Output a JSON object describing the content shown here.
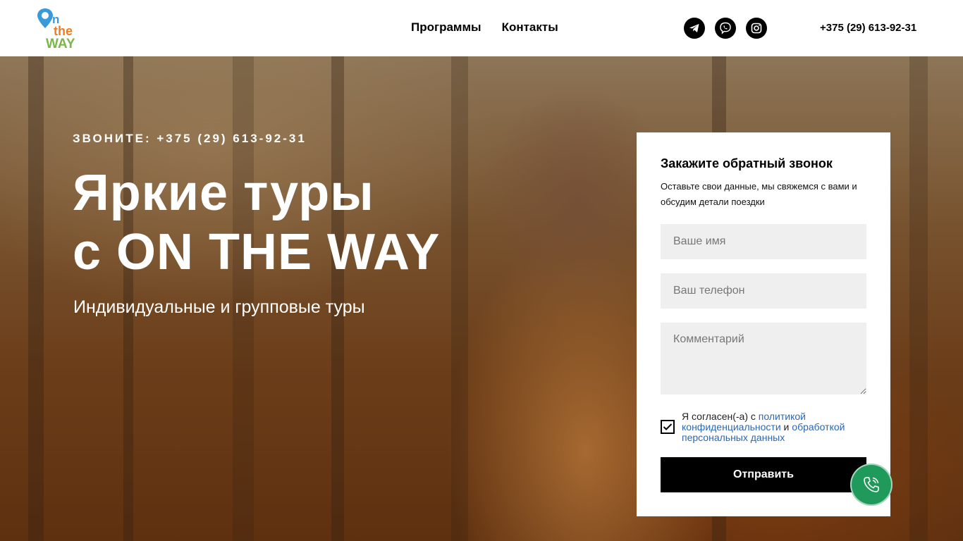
{
  "header": {
    "logo_text": [
      "On",
      "the",
      "WAY"
    ],
    "nav": [
      {
        "label": "Программы"
      },
      {
        "label": "Контакты"
      }
    ],
    "socials": [
      {
        "icon": "telegram-icon"
      },
      {
        "icon": "viber-icon"
      },
      {
        "icon": "instagram-icon"
      }
    ],
    "phone": "+375 (29) 613-92-31"
  },
  "hero": {
    "eyebrow": "ЗВОНИТЕ: +375 (29) 613-92-31",
    "title_line1": "Яркие туры",
    "title_line2": "с ON THE WAY",
    "subtitle": "Индивидуальные и групповые туры"
  },
  "form": {
    "title": "Закажите обратный звонок",
    "description": "Оставьте свои данные, мы свяжемся с вами и обсудим детали поездки",
    "name_placeholder": "Ваше имя",
    "phone_placeholder": "Ваш телефон",
    "comment_placeholder": "Комментарий",
    "consent": {
      "checked": true,
      "text_before": "Я согласен(-а) с ",
      "link1": "политикой конфиденциальности",
      "text_middle": " и ",
      "link2": "обработкой персональных данных"
    },
    "submit_label": "Отправить"
  },
  "colors": {
    "accent": "#000000",
    "link": "#2b67b3",
    "call_button": "#1f9a5a",
    "logo_blue": "#3a9ad9",
    "logo_orange": "#f07c1e",
    "logo_green": "#7ab648"
  }
}
